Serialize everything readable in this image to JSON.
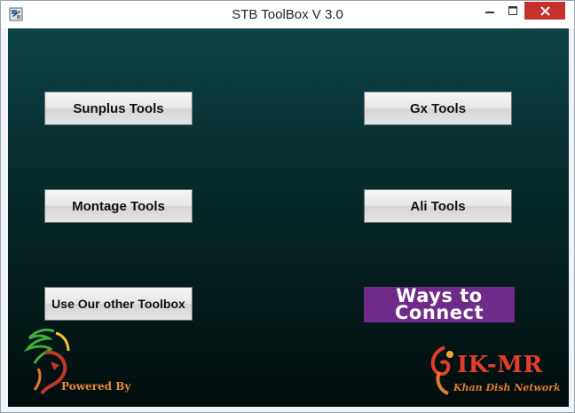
{
  "window": {
    "title": "STB ToolBox V 3.0"
  },
  "buttons": {
    "sunplus": "Sunplus Tools",
    "gx": "Gx Tools",
    "montage": "Montage Tools",
    "ali": "Ali Tools",
    "other": "Use Our other Toolbox"
  },
  "banner": {
    "line1": "Ways to",
    "line2": "Connect"
  },
  "branding": {
    "powered_by": "Powered By",
    "ikmr": "IK-MR",
    "network": "Khan Dish Network"
  },
  "colors": {
    "close_button": "#c7312c",
    "banner_bg": "#6f2a8a",
    "client_bg_top": "#0d4345",
    "client_bg_bottom": "#020d0d"
  },
  "icons": {
    "app": "app-icon",
    "minimize": "minimize-icon",
    "maximize": "maximize-icon",
    "close": "close-icon"
  }
}
